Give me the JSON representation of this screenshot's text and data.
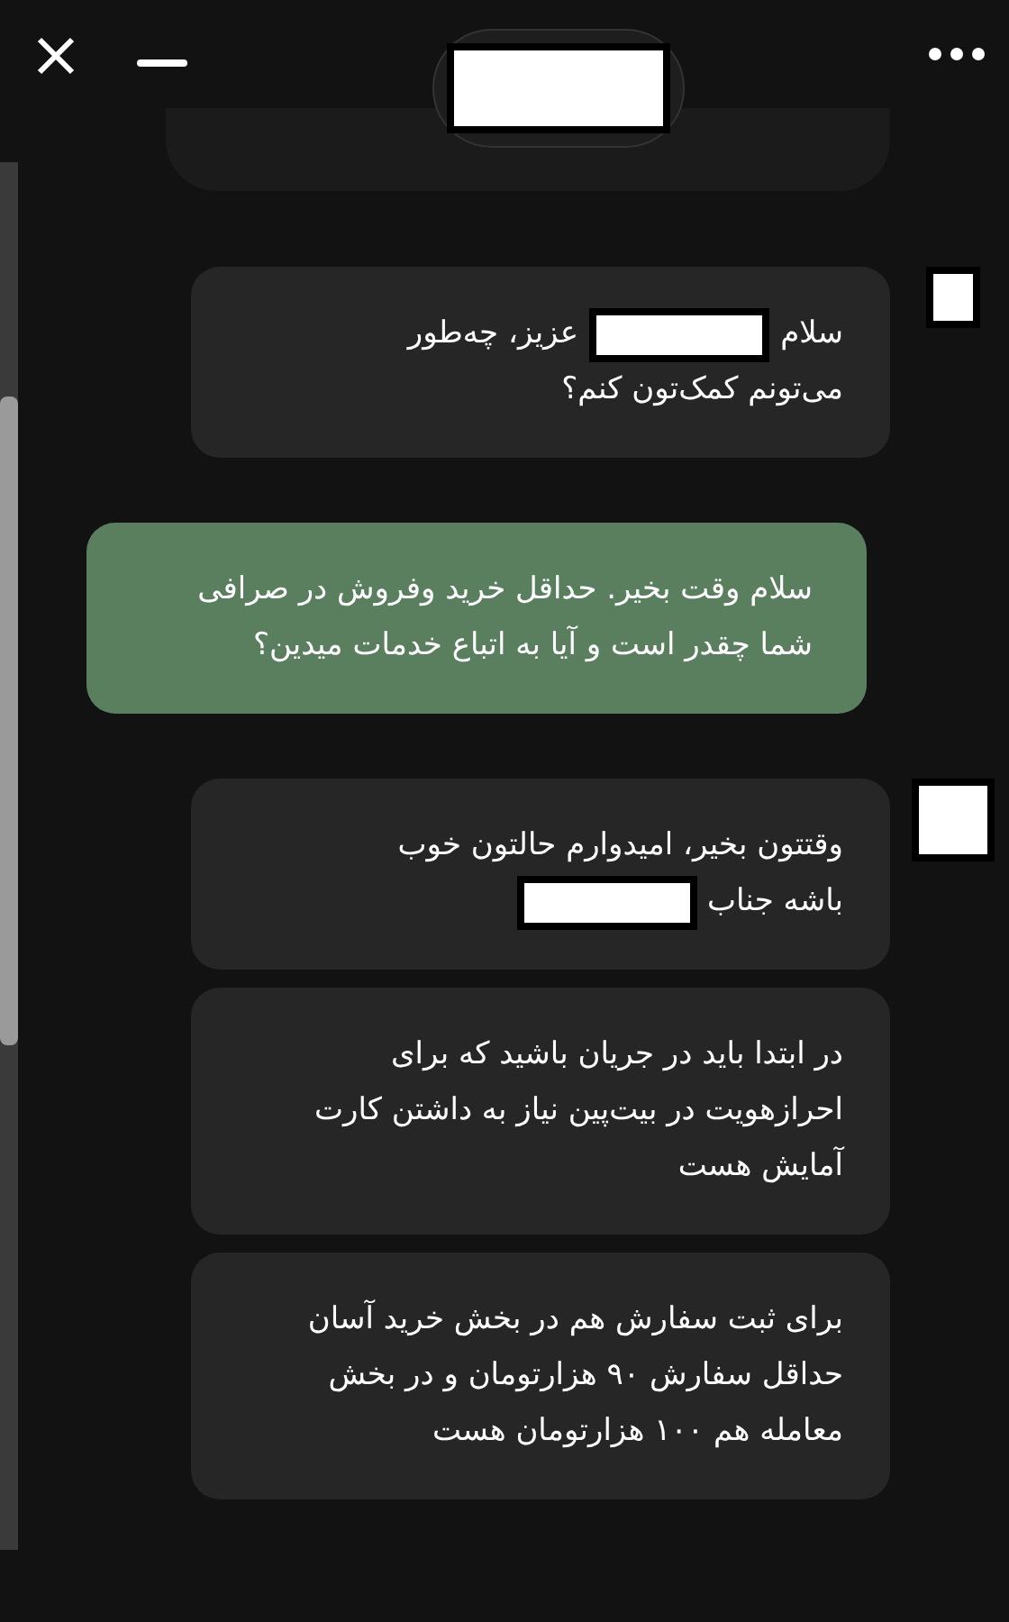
{
  "header": {
    "title": {
      "kind": "redacted"
    }
  },
  "messages": [
    {
      "kind": "agent",
      "avatar": {
        "kind": "redacted"
      },
      "lines": [
        [
          {
            "kind": "text",
            "text": "سلام"
          },
          {
            "kind": "redacted"
          },
          {
            "kind": "text",
            "text": "عزیز، چه‌طور"
          }
        ],
        [
          {
            "kind": "text",
            "text": "می‌تونم کمک‌تون کنم؟"
          }
        ]
      ]
    },
    {
      "kind": "user",
      "text": "سلام وقت بخیر. حداقل خرید وفروش در صرافی شما چقدر است و آیا به اتباع خدمات میدین؟"
    },
    {
      "kind": "agent",
      "avatar": {
        "kind": "redacted"
      },
      "lines": [
        [
          {
            "kind": "text",
            "text": "وقتتون بخیر، امیدوارم حالتون خوب"
          }
        ],
        [
          {
            "kind": "text",
            "text": "باشه جناب"
          },
          {
            "kind": "redacted"
          }
        ]
      ]
    },
    {
      "kind": "agent",
      "text": "در ابتدا باید در جریان باشید که برای احرازهویت در بیت‌پین نیاز به داشتن کارت آمایش هست"
    },
    {
      "kind": "agent",
      "text": "برای ثبت سفارش هم در بخش خرید آسان حداقل سفارش ۹۰ هزارتومان و در بخش معامله هم ۱۰۰ هزارتومان هست"
    }
  ]
}
